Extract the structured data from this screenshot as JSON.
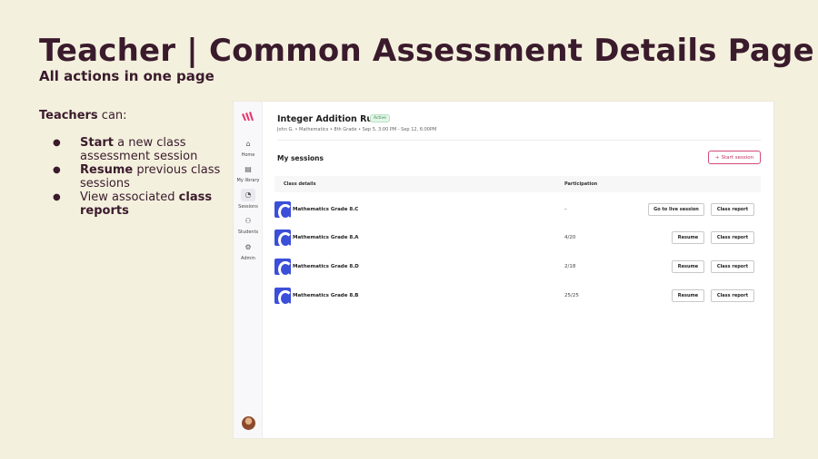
{
  "slide": {
    "title": "Teacher | Common Assessment Details Page",
    "subtitle": "All actions in one page",
    "intro_bold": "Teachers",
    "intro_rest": " can:",
    "bullets": [
      {
        "bold": "Start",
        "rest": " a new class assessment session"
      },
      {
        "bold": "Resume",
        "rest": " previous class sessions"
      },
      {
        "pre": "View associated ",
        "bold": "class reports"
      }
    ]
  },
  "sidebar": {
    "items": [
      {
        "label": "Home",
        "icon": "home-icon",
        "glyph": "⌂"
      },
      {
        "label": "My library",
        "icon": "library-icon",
        "glyph": "▤"
      },
      {
        "label": "Sessions",
        "icon": "sessions-icon",
        "glyph": "◔"
      },
      {
        "label": "Students",
        "icon": "students-icon",
        "glyph": "⚇"
      },
      {
        "label": "Admin",
        "icon": "admin-icon",
        "glyph": "⚙"
      }
    ]
  },
  "assessment": {
    "title": "Integer Addition Rules",
    "status": "Active",
    "meta": "John G.  •  Mathematics  •  8th Grade  •  Sep 5, 3:00 PM - Sep 12, 6:00PM"
  },
  "sessions": {
    "title": "My sessions",
    "start_label": "Start session",
    "columns": {
      "class": "Class details",
      "participation": "Participation"
    },
    "rows": [
      {
        "class": "Mathematics Grade 8.C",
        "participation": "–",
        "primary": "Go to live session",
        "report": "Class report",
        "live": true
      },
      {
        "class": "Mathematics Grade 8.A",
        "participation": "4/20",
        "primary": "Resume",
        "report": "Class report",
        "live": false
      },
      {
        "class": "Mathematics Grade 8.D",
        "participation": "2/18",
        "primary": "Resume",
        "report": "Class report",
        "live": false
      },
      {
        "class": "Mathematics Grade 8.B",
        "participation": "25/25",
        "primary": "Resume",
        "report": "Class report",
        "live": false
      }
    ]
  },
  "colors": {
    "background": "#f4f0de",
    "text": "#3a1b2c",
    "accent": "#c2325f",
    "class_icon": "#3b4fd8"
  }
}
